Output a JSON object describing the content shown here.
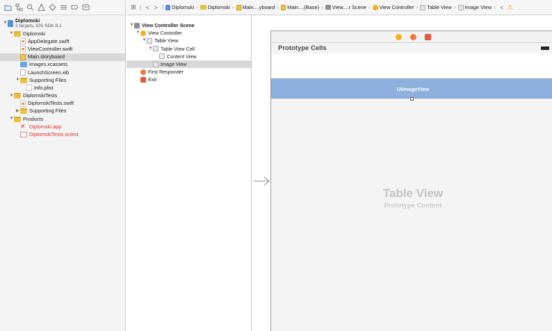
{
  "navigator": {
    "toolbar_icons": [
      "folder-icon",
      "hierarchy-icon",
      "search-icon",
      "warning-icon",
      "test-icon",
      "debug-icon",
      "breakpoint-icon",
      "report-icon"
    ],
    "items": [
      {
        "label": "Diplomski",
        "sub": "2 targets, iOS SDK 8.1",
        "type": "proj",
        "level": 0,
        "disclosure": "▼"
      },
      {
        "label": "Diplomski",
        "type": "folder",
        "level": 1,
        "disclosure": "▼"
      },
      {
        "label": "AppDelegate.swift",
        "type": "swift",
        "level": 2,
        "disclosure": ""
      },
      {
        "label": "ViewController.swift",
        "type": "swift",
        "level": 2,
        "disclosure": ""
      },
      {
        "label": "Main.storyboard",
        "type": "sb",
        "level": 2,
        "disclosure": "",
        "selected": true
      },
      {
        "label": "Images.xcassets",
        "type": "xc",
        "level": 2,
        "disclosure": ""
      },
      {
        "label": "LaunchScreen.xib",
        "type": "xib",
        "level": 2,
        "disclosure": ""
      },
      {
        "label": "Supporting Files",
        "type": "folder",
        "level": 2,
        "disclosure": "▼"
      },
      {
        "label": "Info.plist",
        "type": "plist",
        "level": 3,
        "disclosure": ""
      },
      {
        "label": "DiplomskiTests",
        "type": "folder",
        "level": 1,
        "disclosure": "▼"
      },
      {
        "label": "DiplomskiTests.swift",
        "type": "swift",
        "level": 2,
        "disclosure": ""
      },
      {
        "label": "Supporting Files",
        "type": "folder",
        "level": 2,
        "disclosure": "▶"
      },
      {
        "label": "Products",
        "type": "folder",
        "level": 1,
        "disclosure": "▼"
      },
      {
        "label": "Diplomski.app",
        "type": "app",
        "level": 2,
        "disclosure": "",
        "red": true
      },
      {
        "label": "DiplomskiTests.xctest",
        "type": "xct",
        "level": 2,
        "disclosure": "",
        "red": true
      }
    ]
  },
  "jumpbar": {
    "items": [
      {
        "label": "Diplomski",
        "icon": "proj"
      },
      {
        "label": "Diplomski",
        "icon": "folder"
      },
      {
        "label": "Main....yboard",
        "icon": "sb"
      },
      {
        "label": "Main....(Base)",
        "icon": "sb"
      },
      {
        "label": "View....r Scene",
        "icon": "scene"
      },
      {
        "label": "View Controller",
        "icon": "vc"
      },
      {
        "label": "Table View",
        "icon": "tv"
      },
      {
        "label": "Image View",
        "icon": "tv"
      }
    ],
    "back": "<",
    "forward": ">",
    "related": "⊞",
    "warning": "⚠"
  },
  "outline": {
    "items": [
      {
        "label": "View Controller Scene",
        "icon": "scene",
        "level": 0,
        "disclosure": "▼",
        "bold": true
      },
      {
        "label": "View Controller",
        "icon": "vc",
        "level": 1,
        "disclosure": "▼"
      },
      {
        "label": "Table View",
        "icon": "tv",
        "level": 2,
        "disclosure": "▼"
      },
      {
        "label": "Table View Cell",
        "icon": "tv",
        "level": 3,
        "disclosure": "▼"
      },
      {
        "label": "Content View",
        "icon": "tv",
        "level": 4,
        "disclosure": ""
      },
      {
        "label": "Image View",
        "icon": "tv",
        "level": 3,
        "disclosure": "",
        "selected": true
      },
      {
        "label": "First Responder",
        "icon": "fr",
        "level": 1,
        "disclosure": ""
      },
      {
        "label": "Exit",
        "icon": "exit",
        "level": 1,
        "disclosure": ""
      }
    ]
  },
  "canvas": {
    "prototype_cells": "Prototype Cells",
    "image_view": "UIImageView",
    "table_view": "Table View",
    "prototype_content": "Prototype Content"
  },
  "colors": {
    "selection": "#d8d8d8",
    "imageview": "#8fb0de",
    "red_text": "#d0312d"
  }
}
